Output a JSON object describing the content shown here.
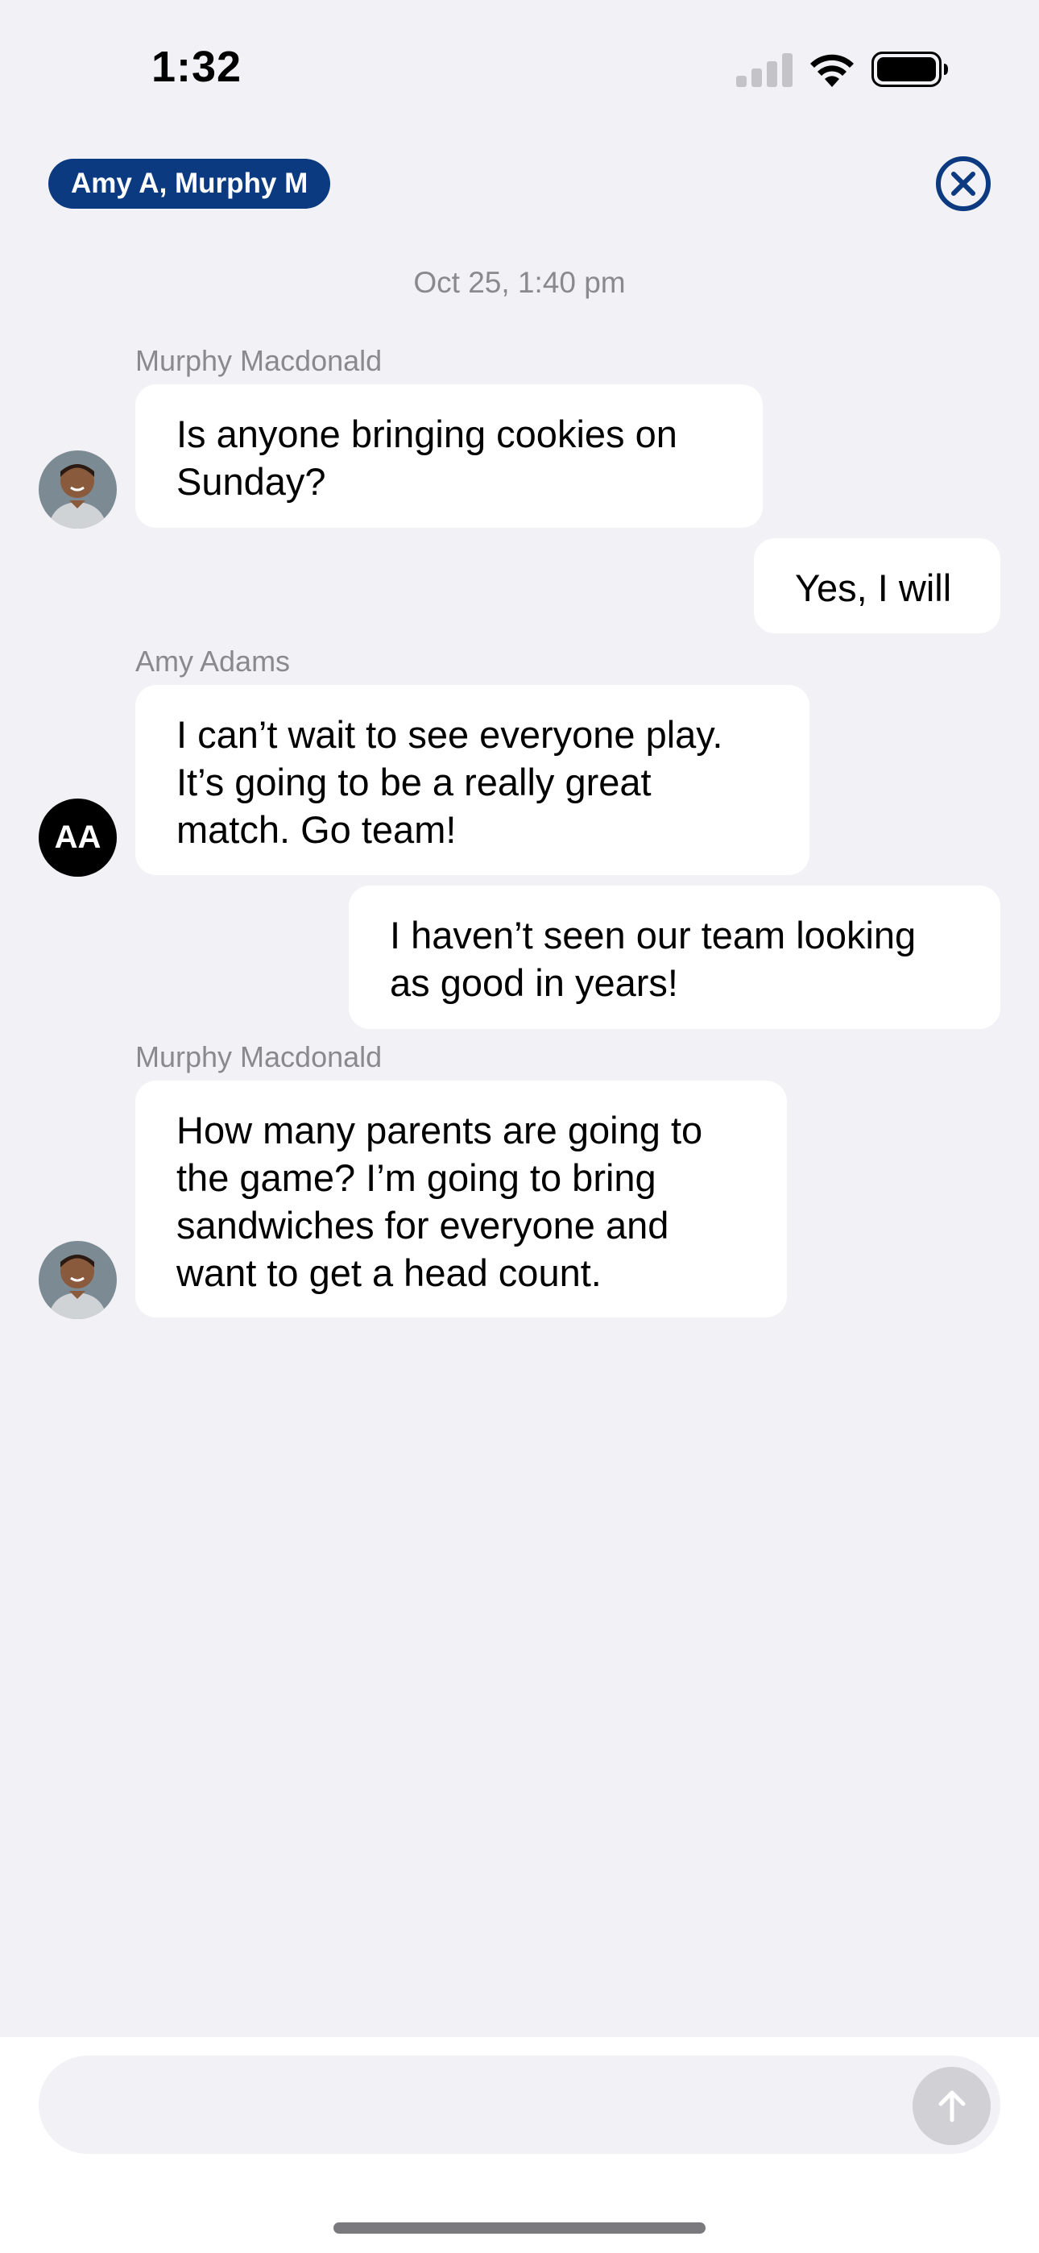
{
  "status_bar": {
    "time": "1:32",
    "icons": [
      "cellular-signal-icon",
      "wifi-icon",
      "battery-icon"
    ]
  },
  "header": {
    "participants_chip": "Amy A, Murphy M",
    "close_icon": "close-circle-icon"
  },
  "conversation": {
    "timestamp": "Oct 25, 1:40 pm",
    "messages": [
      {
        "sender": "Murphy Macdonald",
        "direction": "incoming",
        "lines": [
          "Is anyone bringing cookies on",
          "Sunday?"
        ],
        "avatar": "photo"
      },
      {
        "sender": "",
        "direction": "outgoing",
        "lines": [
          "Yes, I will"
        ]
      },
      {
        "sender": "Amy Adams",
        "direction": "incoming",
        "lines": [
          "I can’t wait to see everyone play.",
          "It’s going to be a really great",
          "match. Go team!"
        ],
        "avatar": "initials",
        "initials": "AA"
      },
      {
        "sender": "",
        "direction": "outgoing",
        "lines": [
          "I haven’t seen our team looking",
          "as good in years!"
        ]
      },
      {
        "sender": "Murphy Macdonald",
        "direction": "incoming",
        "lines": [
          "How many parents are going to",
          "the game? I’m going to bring",
          "sandwiches for everyone and",
          "want to get a head count."
        ],
        "avatar": "photo"
      }
    ]
  },
  "composer": {
    "placeholder": "",
    "send_icon": "arrow-up-icon"
  },
  "colors": {
    "background": "#f1f1f6",
    "chip": "#0b3a80",
    "bubble": "#ffffff",
    "muted_text": "#8a8a8e",
    "send_disabled": "#d0d0d5"
  }
}
